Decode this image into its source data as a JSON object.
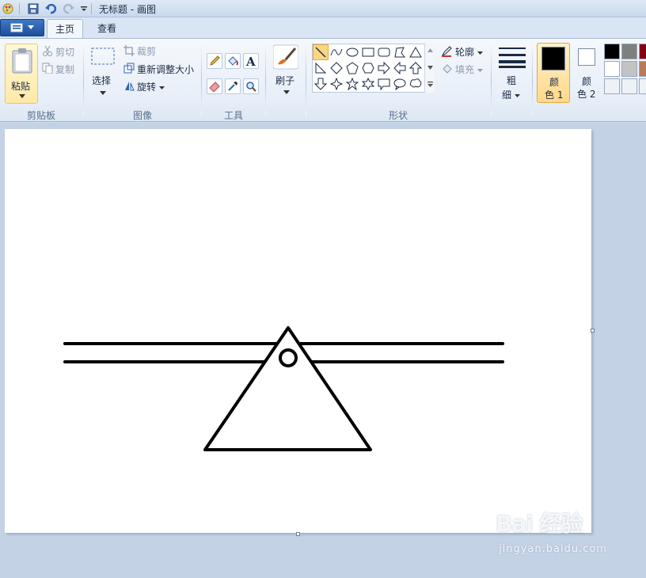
{
  "titlebar": {
    "title": "无标题 - 画图",
    "qa_icons": [
      "paint-app-icon",
      "save-icon",
      "undo-icon",
      "redo-icon",
      "customize-dropdown-icon"
    ]
  },
  "tabs": [
    {
      "label": "主页",
      "active": true
    },
    {
      "label": "查看",
      "active": false
    }
  ],
  "ribbon": {
    "clipboard": {
      "group_label": "剪贴板",
      "paste": "粘贴",
      "cut": "剪切",
      "copy": "复制"
    },
    "image": {
      "group_label": "图像",
      "select": "选择",
      "crop": "裁剪",
      "resize": "重新调整大小",
      "rotate": "旋转"
    },
    "tools": {
      "group_label": "工具",
      "items": [
        "pencil-icon",
        "fill-bucket-icon",
        "text-icon",
        "eraser-icon",
        "color-picker-icon",
        "magnifier-icon"
      ]
    },
    "brushes": {
      "label": "刷子"
    },
    "shapes": {
      "group_label": "形状",
      "outline": "轮廓",
      "fill": "填充",
      "selected_shape": "line"
    },
    "size": {
      "line1": "粗",
      "line2": "细"
    },
    "colors": {
      "color1_line1": "颜",
      "color1_line2": "色 1",
      "color2_line1": "颜",
      "color2_line2": "色 2",
      "color1_value": "#000000",
      "color2_value": "#ffffff",
      "palette": [
        "#000000",
        "#7f7f7f",
        "#880015",
        "#ffffff",
        "#c3c3c3",
        "#b97a57",
        "#f0f0f0",
        "#f0f0f0",
        "#f0f0f0"
      ]
    }
  },
  "canvas": {
    "background": "#ffffff",
    "stroke_color": "#000000",
    "drawing": "lever-on-triangle-fulcrum"
  },
  "watermark": {
    "logo": "Bai 经验",
    "url": "jingyan.baidu.com"
  }
}
